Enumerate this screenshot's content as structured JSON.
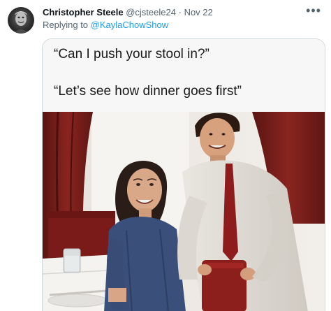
{
  "tweet": {
    "author_name": "Christopher Steele",
    "author_handle": "@cjsteele24",
    "separator": "·",
    "date": "Nov 22",
    "more_icon": "more-horizontal-icon",
    "reply_prefix": "Replying to ",
    "reply_handle": "@KaylaChowShow"
  },
  "meme": {
    "caption_line_1": "“Can I push your stool in?”",
    "caption_line_2": "“Let’s see how dinner goes first”"
  },
  "colors": {
    "link": "#1d9bf0",
    "secondary_text": "#536471",
    "primary_text": "#0f1419"
  }
}
